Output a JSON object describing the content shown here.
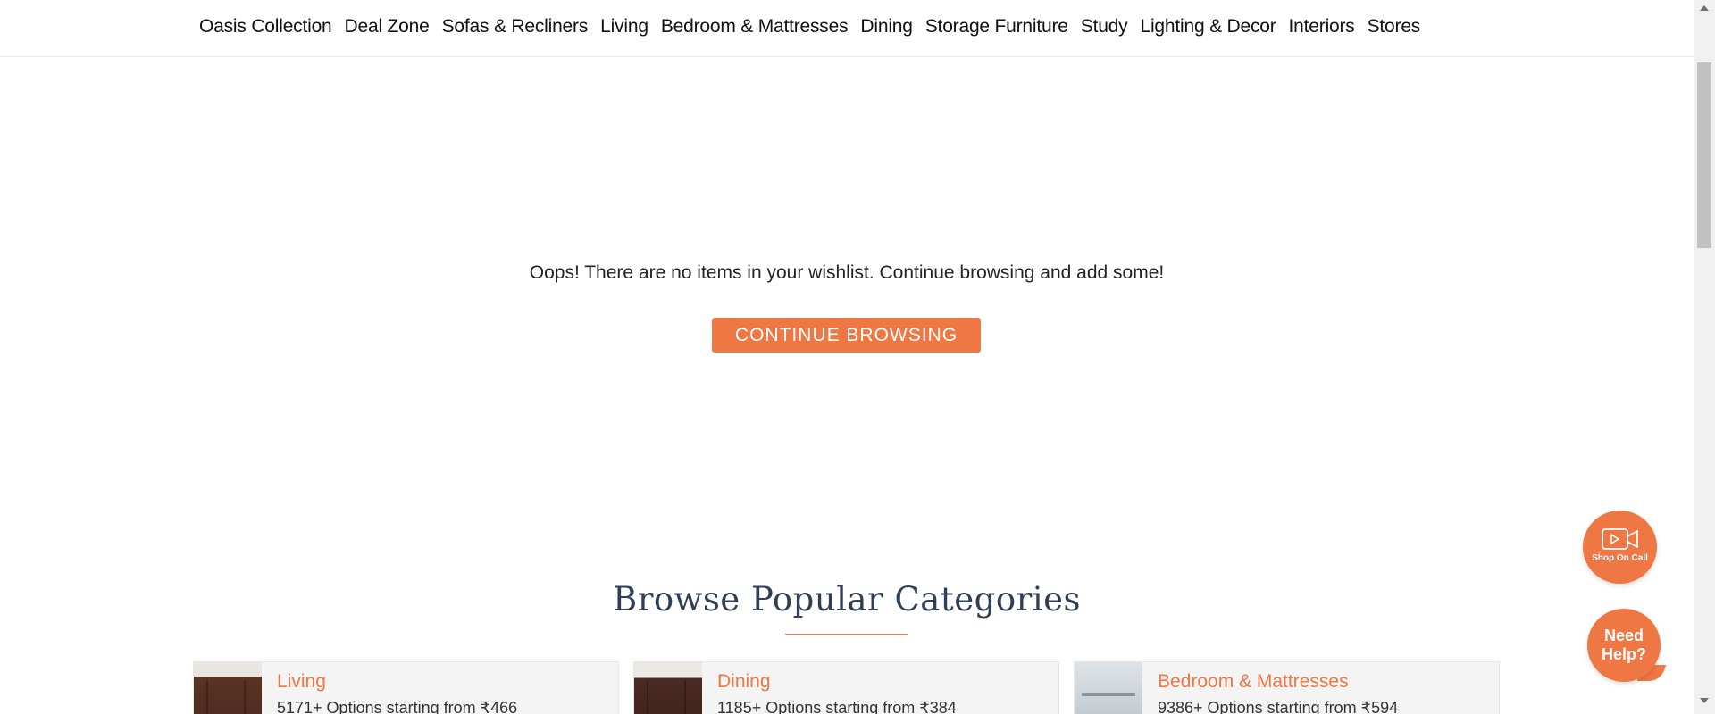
{
  "nav": {
    "items": [
      {
        "label": "Oasis Collection"
      },
      {
        "label": "Deal Zone"
      },
      {
        "label": "Sofas & Recliners"
      },
      {
        "label": "Living"
      },
      {
        "label": "Bedroom & Mattresses"
      },
      {
        "label": "Dining"
      },
      {
        "label": "Storage Furniture"
      },
      {
        "label": "Study"
      },
      {
        "label": "Lighting & Decor"
      },
      {
        "label": "Interiors"
      },
      {
        "label": "Stores"
      }
    ]
  },
  "wishlist": {
    "empty_message": "Oops! There are no items in your wishlist. Continue browsing and add some!",
    "continue_label": "CONTINUE BROWSING"
  },
  "categories": {
    "title": "Browse Popular Categories",
    "cards": [
      {
        "title": "Living",
        "subtitle": "5171+ Options starting from ₹466"
      },
      {
        "title": "Dining",
        "subtitle": "1185+ Options starting from ₹384"
      },
      {
        "title": "Bedroom & Mattresses",
        "subtitle": "9386+ Options starting from ₹594"
      }
    ]
  },
  "floating": {
    "shop_on_call_label": "Shop On Call",
    "shop_on_call_icon": "video-camera-icon",
    "need_help_label": "Need Help?"
  },
  "colors": {
    "accent": "#ef7743",
    "heading": "#2f3f55"
  }
}
